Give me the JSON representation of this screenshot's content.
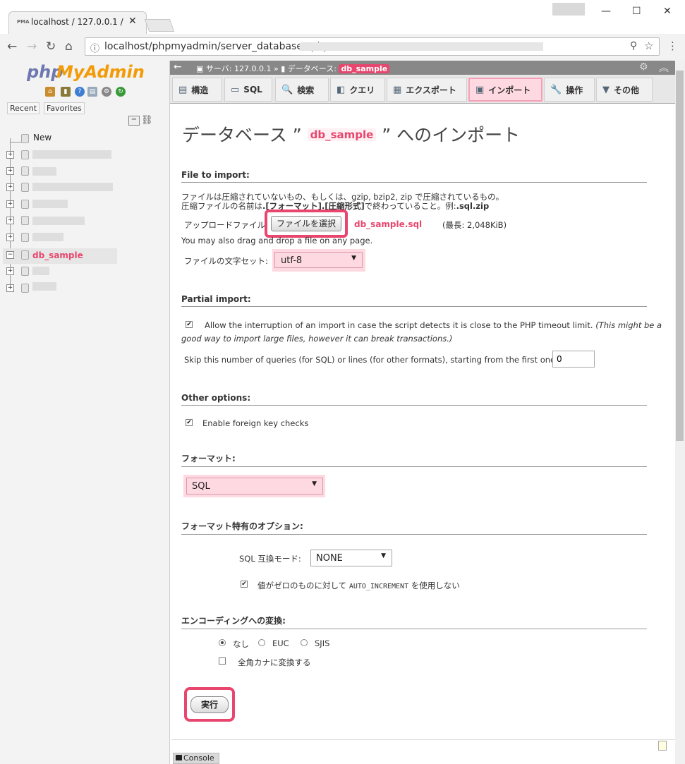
{
  "browser": {
    "tab_title": "localhost / 127.0.0.1 /",
    "url": "localhost/phpmyadmin/server_databases.php",
    "win_minimize": "—",
    "win_maximize": "☐",
    "win_close": "✕"
  },
  "nav": {
    "logo_php": "php",
    "logo_myadmin": "MyAdmin",
    "recent_label": "Recent",
    "favorites_label": "Favorites",
    "new_label": "New",
    "selected_db": "db_sample"
  },
  "breadcrumb": {
    "server_label": "サーバ: 127.0.0.1",
    "separator": "»",
    "db_label": "データベース:",
    "db_name": "db_sample"
  },
  "tabs": [
    {
      "label": "構造",
      "icon": "structure-icon",
      "glyph": "▤"
    },
    {
      "label": "SQL",
      "icon": "sql-icon",
      "glyph": "▭"
    },
    {
      "label": "検索",
      "icon": "search-icon",
      "glyph": "🔍"
    },
    {
      "label": "クエリ",
      "icon": "query-icon",
      "glyph": "◧"
    },
    {
      "label": "エクスポート",
      "icon": "export-icon",
      "glyph": "▦"
    },
    {
      "label": "インポート",
      "icon": "import-icon",
      "glyph": "▣",
      "active": true
    },
    {
      "label": "操作",
      "icon": "wrench-icon",
      "glyph": "🔧"
    },
    {
      "label": "その他",
      "icon": "chevron-down-icon",
      "glyph": "▼"
    }
  ],
  "page": {
    "title_prefix": "データベース ”",
    "title_db": "db_sample",
    "title_suffix": "” へのインポート"
  },
  "file_section": {
    "heading": "File to import:",
    "desc_line1": "ファイルは圧縮されていないもの、もしくは、gzip, bzip2, zip で圧縮されているもの。",
    "desc_line2_a": "圧縮ファイルの名前は",
    "desc_line2_b": ".[フォーマット].[圧縮形式]",
    "desc_line2_c": "で終わっていること。例:",
    "desc_line2_d": ".sql.zip",
    "upload_label": "アップロードファイル:",
    "choose_button": "ファイルを選択",
    "chosen_file": "db_sample.sql",
    "max_size": "(最長: 2,048KiB)",
    "drag_hint": "You may also drag and drop a file on any page.",
    "charset_label": "ファイルの文字セット:",
    "charset_value": "utf-8"
  },
  "partial_section": {
    "heading": "Partial import:",
    "allow_interrupt_label": "Allow the interruption of an import in case the script detects it is close to the PHP timeout limit.",
    "allow_interrupt_note_a": "(This might be a",
    "allow_interrupt_note_b": "good way to import large files, however it can break transactions.)",
    "allow_interrupt_checked": true,
    "skip_label": "Skip this number of queries (for SQL) or lines (for other formats), starting from the first one:",
    "skip_value": "0"
  },
  "other_section": {
    "heading": "Other options:",
    "fk_label": "Enable foreign key checks",
    "fk_checked": true
  },
  "format_section": {
    "heading": "フォーマット:",
    "format_value": "SQL"
  },
  "format_options": {
    "heading": "フォーマット特有のオプション:",
    "compat_label": "SQL 互換モード:",
    "compat_value": "NONE",
    "autoinc_label_a": "値がゼロのものに対して",
    "autoinc_label_b": "AUTO_INCREMENT",
    "autoinc_label_c": "を使用しない",
    "autoinc_checked": true
  },
  "encoding_section": {
    "heading": "エンコーディングへの変換:",
    "options": [
      "なし",
      "EUC",
      "SJIS"
    ],
    "selected": "なし",
    "kana_label": "全角カナに変換する",
    "kana_checked": false
  },
  "actions": {
    "go_button": "実行",
    "console_label": "Console"
  },
  "colors": {
    "highlight": "#e8466e",
    "highlight_fill": "#ffd9e2",
    "logo_blue": "#6c78af",
    "logo_orange": "#f29b06"
  }
}
